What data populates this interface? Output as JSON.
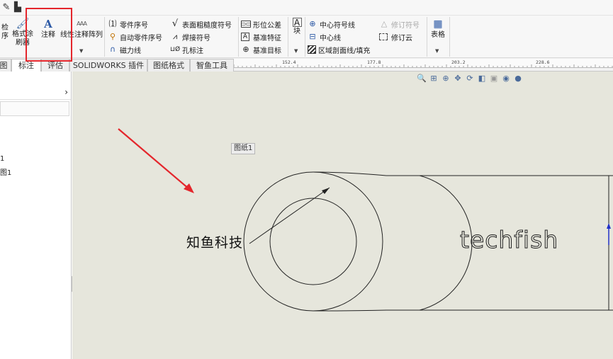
{
  "quick_access": {
    "icons": [
      "drawing-tool-icon",
      "view-layout-icon"
    ]
  },
  "ribbon": {
    "group1": {
      "label_check_top": "检",
      "label_check_bottom": "序",
      "format_painter_top": "格式涂",
      "format_painter_bottom": "刷器"
    },
    "note": {
      "label": "注释"
    },
    "linear_pattern": {
      "label": "线性注释阵列"
    },
    "group2": {
      "balloon": "零件序号",
      "auto_balloon": "自动零件序号",
      "magnetic_line": "磁力线"
    },
    "group3": {
      "surface_finish": "表面粗糙度符号",
      "weld_symbol": "焊接符号",
      "hole_callout": "孔标注"
    },
    "group4": {
      "gdt": "形位公差",
      "datum_feature": "基准特征",
      "datum_target": "基准目标"
    },
    "block": {
      "label": "块"
    },
    "group5": {
      "center_mark": "中心符号线",
      "centerline": "中心线",
      "area_hatch": "区域剖面线/填充"
    },
    "group6": {
      "revision_symbol": "修订符号",
      "revision_cloud": "修订云"
    },
    "table": {
      "label": "表格"
    }
  },
  "tabs": [
    {
      "label": "图"
    },
    {
      "label": "标注"
    },
    {
      "label": "评估"
    },
    {
      "label": "SOLIDWORKS 插件"
    },
    {
      "label": "图纸格式"
    },
    {
      "label": "智鱼工具"
    }
  ],
  "ruler": {
    "marks": [
      "152.4",
      "177.8",
      "203.2",
      "228.6"
    ]
  },
  "left_panel": {
    "tree_item_1": "1",
    "tree_item_2": "图1"
  },
  "canvas": {
    "sheet_label": "图纸1",
    "note_text": "知鱼科技",
    "engraved_text": "techfish"
  },
  "colors": {
    "accent_red": "#e4262c",
    "canvas_bg": "#e6e6dc",
    "ribbon_bg": "#f7f7f7"
  }
}
